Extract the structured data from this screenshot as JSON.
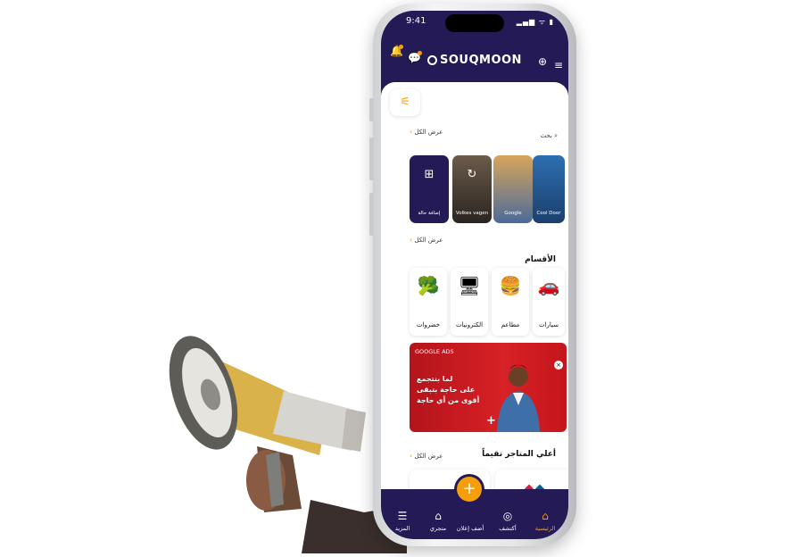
{
  "status": {
    "time": "9:41",
    "indicators": "▂▄▆ ᯤ ▮"
  },
  "header": {
    "brand": "SOUQMOON",
    "icons": [
      "menu-icon",
      "globe-icon",
      "bell-icon",
      "chat-icon"
    ]
  },
  "search": {
    "label": "بحث",
    "view_all": "عرض الكل"
  },
  "stories": [
    {
      "label": "إضافة حالة",
      "icon": "add-icon"
    },
    {
      "label": "Volkes vagen",
      "icon": "refresh-icon"
    },
    {
      "label": "Google",
      "icon": "logo"
    },
    {
      "label": "Cool Door",
      "icon": "logo"
    }
  ],
  "stories_view_all": "عرض الكل",
  "categories": {
    "title": "الأقسام",
    "items": [
      {
        "label": "خضروات",
        "icon": "🥦"
      },
      {
        "label": "الكترونيات",
        "icon": "🖥"
      },
      {
        "label": "مطاعم",
        "icon": "🍔"
      },
      {
        "label": "سيارات",
        "icon": "🚗"
      }
    ]
  },
  "ad": {
    "tag": "GOOGLE ADS",
    "lines": [
      "لما بنتجمع",
      "على حاجة بتبقى",
      "أقوى من أي حاجة"
    ],
    "close": "×",
    "plus": "+"
  },
  "top_stores": {
    "title": "أعلي المتاجر تقيماً",
    "view_all": "عرض الكل"
  },
  "tabbar": {
    "items": [
      {
        "label": "المزيد",
        "icon": "☰"
      },
      {
        "label": "متجري",
        "icon": "⌂"
      },
      {
        "label": "أضف إعلان",
        "icon": "+"
      },
      {
        "label": "أكتشف",
        "icon": "◎"
      },
      {
        "label": "الرئيسية",
        "icon": "⌂"
      }
    ]
  },
  "colors": {
    "primary": "#241a56",
    "accent": "#f59e0b",
    "ad_red": "#d72126"
  }
}
